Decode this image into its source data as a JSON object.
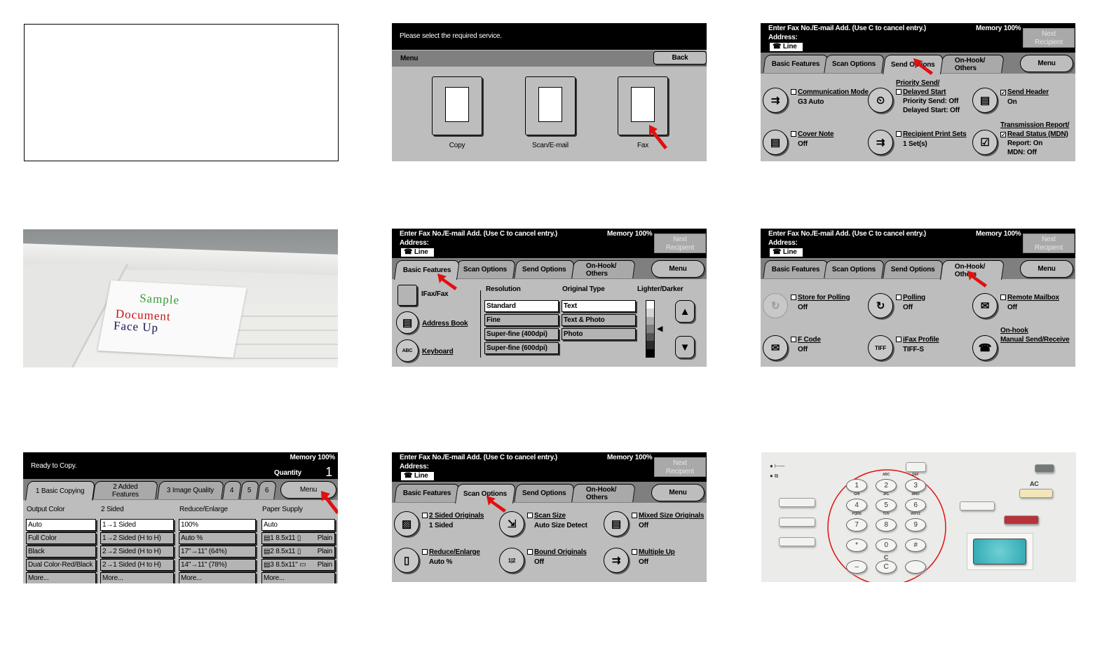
{
  "fax_common": {
    "prompt": "Enter Fax No./E-mail Add. (Use C to cancel entry.)",
    "address_label": "Address:",
    "line_label": "☎ Line",
    "memory": "Memory 100%",
    "next_recipient": [
      "Next",
      "Recipient"
    ],
    "tabs": [
      "Basic Features",
      "Scan Options",
      "Send Options",
      "On-Hook/ Others"
    ],
    "menu": "Menu"
  },
  "menu_screen": {
    "prompt": "Please select the required service.",
    "title": "Menu",
    "back": "Back",
    "services": [
      {
        "label": "Copy",
        "icon": "copier-icon"
      },
      {
        "label": "Scan/E-mail",
        "icon": "scanner-icon"
      },
      {
        "label": "Fax",
        "icon": "fax-machine-icon"
      }
    ]
  },
  "send_options": {
    "active_tab": 2,
    "items": [
      {
        "icon": "communication-mode-icon",
        "glyph": "⇉",
        "label": [
          "Communication Mode"
        ],
        "values": [
          "G3 Auto"
        ],
        "checked": false
      },
      {
        "icon": "delayed-start-icon",
        "glyph": "⏲",
        "label": [
          "Priority Send/",
          "Delayed Start"
        ],
        "values": [
          "Priority Send: Off",
          "Delayed Start: Off"
        ],
        "checked": false
      },
      {
        "icon": "send-header-icon",
        "glyph": "▤",
        "label": [
          "Send Header"
        ],
        "values": [
          "On"
        ],
        "checked": true
      },
      {
        "icon": "cover-note-icon",
        "glyph": "▤",
        "label": [
          "Cover Note"
        ],
        "values": [
          "Off"
        ],
        "checked": false
      },
      {
        "icon": "recipient-print-sets-icon",
        "glyph": "⇉",
        "label": [
          "Recipient Print Sets"
        ],
        "values": [
          "1 Set(s)"
        ],
        "checked": false
      },
      {
        "icon": "transmission-report-icon",
        "glyph": "☑",
        "label": [
          "Transmission Report/",
          "Read Status (MDN)"
        ],
        "values": [
          "Report: On",
          "MDN: Off"
        ],
        "checked": true
      }
    ]
  },
  "basic_features": {
    "active_tab": 0,
    "ifax_fax": "IFax/Fax",
    "address_book": "Address Book",
    "keyboard": "Keyboard",
    "keyboard_icon": "ABC",
    "resolution_header": "Resolution",
    "resolution_options": [
      "Standard",
      "Fine",
      "Super-fine (400dpi)",
      "Super-fine (600dpi)"
    ],
    "resolution_selected": 0,
    "original_type_header": "Original Type",
    "original_type_options": [
      "Text",
      "Text & Photo",
      "Photo"
    ],
    "original_type_selected": 0,
    "lighter_darker_header": "Lighter/Darker",
    "lighter_darker_level": 4,
    "lighter_darker_steps": 7
  },
  "on_hook": {
    "active_tab": 3,
    "items": [
      {
        "icon": "store-for-polling-icon",
        "glyph": "↻",
        "label": [
          "Store for Polling"
        ],
        "values": [
          "Off"
        ],
        "checked": false,
        "disabled": true
      },
      {
        "icon": "polling-icon",
        "glyph": "↻",
        "label": [
          "Polling"
        ],
        "values": [
          "Off"
        ],
        "checked": false
      },
      {
        "icon": "remote-mailbox-icon",
        "glyph": "✉",
        "label": [
          "Remote Mailbox"
        ],
        "values": [
          "Off"
        ],
        "checked": false
      },
      {
        "icon": "f-code-icon",
        "glyph": "✉",
        "label": [
          "F Code"
        ],
        "values": [
          "Off"
        ],
        "checked": false
      },
      {
        "icon": "ifax-profile-icon",
        "glyph": "TIFF",
        "label": [
          "iFax Profile"
        ],
        "values": [
          "TIFF-S"
        ],
        "checked": false
      },
      {
        "icon": "on-hook-phone-icon",
        "glyph": "☎",
        "label": [
          "On-hook",
          "Manual Send/Receive"
        ],
        "values": [],
        "nocheck": true
      }
    ]
  },
  "scan_options": {
    "active_tab": 1,
    "items": [
      {
        "icon": "two-sided-originals-icon",
        "glyph": "▨",
        "label": [
          "2 Sided Originals"
        ],
        "values": [
          "1 Sided"
        ],
        "checked": false
      },
      {
        "icon": "scan-size-icon",
        "glyph": "⇲",
        "label": [
          "Scan Size"
        ],
        "values": [
          "Auto Size Detect"
        ],
        "checked": false
      },
      {
        "icon": "mixed-size-originals-icon",
        "glyph": "▤",
        "label": [
          "Mixed Size Originals"
        ],
        "values": [
          "Off"
        ],
        "checked": false
      },
      {
        "icon": "reduce-enlarge-icon",
        "glyph": "▯",
        "label": [
          "Reduce/Enlarge"
        ],
        "values": [
          "Auto %"
        ],
        "checked": false
      },
      {
        "icon": "bound-originals-icon",
        "glyph": "1|2",
        "label": [
          "Bound Originals"
        ],
        "values": [
          "Off"
        ],
        "checked": false
      },
      {
        "icon": "multiple-up-icon",
        "glyph": "⇉",
        "label": [
          "Multiple Up"
        ],
        "values": [
          "Off"
        ],
        "checked": false
      }
    ]
  },
  "copy_screen": {
    "status": "Ready to Copy.",
    "memory": "Memory 100%",
    "quantity_label": "Quantity",
    "quantity": "1",
    "tabs": [
      "1 Basic Copying",
      "2 Added Features",
      "3 Image Quality",
      "4",
      "5",
      "6"
    ],
    "active_tab": 0,
    "menu": "Menu",
    "columns": [
      {
        "header": "Output Color",
        "options": [
          "Auto",
          "Full Color",
          "Black",
          "Dual Color-Red/Black",
          "More..."
        ]
      },
      {
        "header": "2 Sided",
        "options": [
          "1→1 Sided",
          "1→2 Sided (H to H)",
          "2→2 Sided (H to H)",
          "2→1 Sided (H to H)",
          "More..."
        ]
      },
      {
        "header": "Reduce/Enlarge",
        "options": [
          "100%",
          "Auto %",
          "17\"→11\" (64%)",
          "14\"→11\" (78%)",
          "More..."
        ]
      },
      {
        "header": "Paper Supply",
        "options": [
          "Auto",
          "▤1  8.5x11 ▯",
          "▤2  8.5x11 ▯",
          "▤3  8.5x11\" ▭",
          "More..."
        ],
        "suffix": [
          "",
          "Plain",
          "Plain",
          "Plain",
          ""
        ]
      }
    ]
  },
  "document_photo": {
    "lines": [
      "Sample",
      "Document",
      "Face Up"
    ],
    "colors": [
      "#3a9a3a",
      "#cc1111",
      "#14145a"
    ]
  },
  "keypad": {
    "keys": [
      {
        "digit": "1",
        "letters": ""
      },
      {
        "digit": "2",
        "letters": "ABC"
      },
      {
        "digit": "3",
        "letters": "DEF"
      },
      {
        "digit": "4",
        "letters": "GHI"
      },
      {
        "digit": "5",
        "letters": "JKL"
      },
      {
        "digit": "6",
        "letters": "MNO"
      },
      {
        "digit": "7",
        "letters": "PQRS"
      },
      {
        "digit": "8",
        "letters": "TUV"
      },
      {
        "digit": "9",
        "letters": "WXYZ"
      },
      {
        "digit": "*",
        "letters": ""
      },
      {
        "digit": "0",
        "letters": ""
      },
      {
        "digit": "#",
        "letters": ""
      },
      {
        "digit": "–",
        "letters": ""
      },
      {
        "digit": "C",
        "letters": "C"
      },
      {
        "digit": "",
        "letters": ""
      }
    ],
    "ac_label": "AC",
    "colors": {
      "start": "#3fb8c0",
      "stop": "#b8323a",
      "ac": "#f3e6b8",
      "highlight": "#e01010"
    }
  },
  "colors": {
    "screen_bg": "#bdbdbd",
    "header_bg": "#000000",
    "arrow": "#e01010"
  }
}
